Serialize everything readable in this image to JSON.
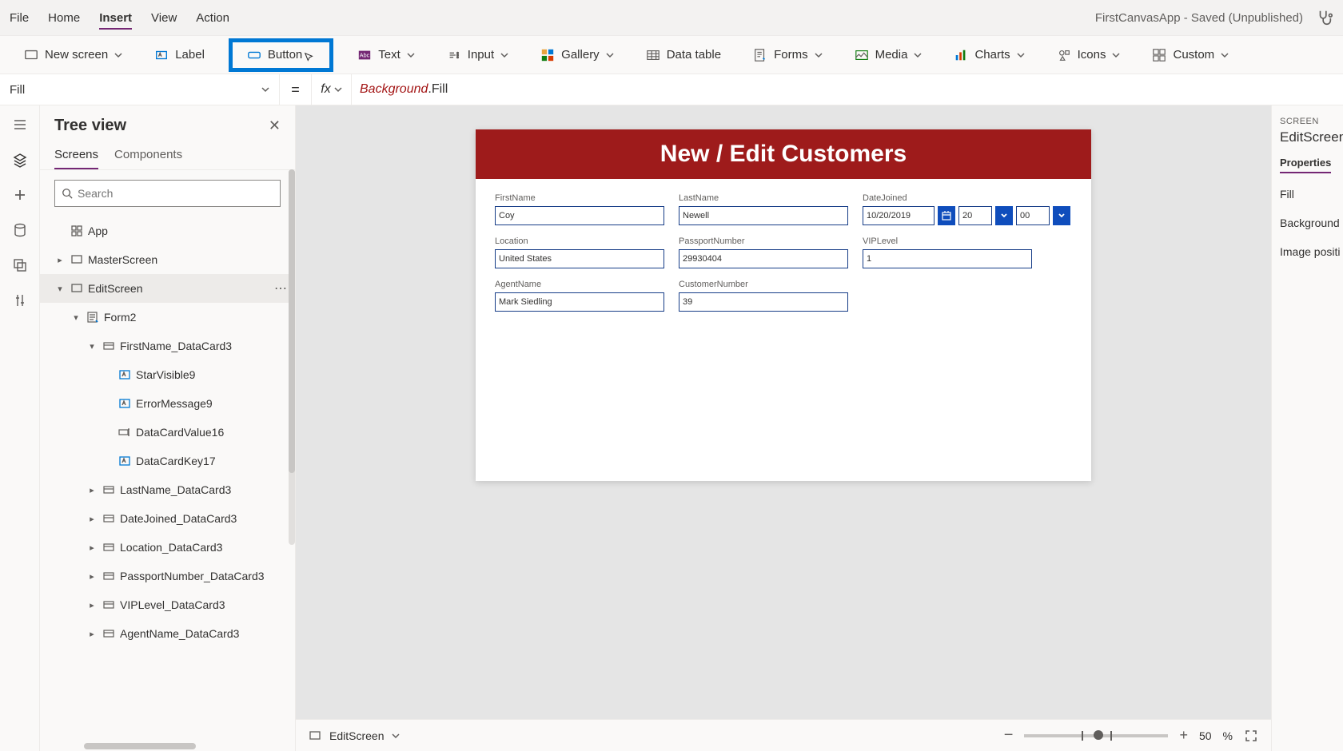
{
  "menubar": {
    "items": [
      "File",
      "Home",
      "Insert",
      "View",
      "Action"
    ],
    "activeIndex": 2,
    "status": "FirstCanvasApp - Saved (Unpublished)"
  },
  "ribbon": {
    "new_screen": "New screen",
    "label": "Label",
    "button": "Button",
    "text": "Text",
    "input": "Input",
    "gallery": "Gallery",
    "data_table": "Data table",
    "forms": "Forms",
    "media": "Media",
    "charts": "Charts",
    "icons": "Icons",
    "custom": "Custom"
  },
  "formula": {
    "property": "Fill",
    "eq": "=",
    "fx": "fx",
    "token_obj": "Background",
    "token_prop": ".Fill"
  },
  "tree": {
    "title": "Tree view",
    "tabs": [
      "Screens",
      "Components"
    ],
    "activeTab": 0,
    "search_placeholder": "Search",
    "nodes": [
      {
        "label": "App",
        "depth": 0,
        "icon": "app",
        "caret": "none"
      },
      {
        "label": "MasterScreen",
        "depth": 0,
        "icon": "screen",
        "caret": "closed"
      },
      {
        "label": "EditScreen",
        "depth": 0,
        "icon": "screen",
        "caret": "open",
        "selected": true,
        "more": true
      },
      {
        "label": "Form2",
        "depth": 1,
        "icon": "form",
        "caret": "open"
      },
      {
        "label": "FirstName_DataCard3",
        "depth": 2,
        "icon": "card",
        "caret": "open"
      },
      {
        "label": "StarVisible9",
        "depth": 3,
        "icon": "label",
        "caret": "none"
      },
      {
        "label": "ErrorMessage9",
        "depth": 3,
        "icon": "label",
        "caret": "none"
      },
      {
        "label": "DataCardValue16",
        "depth": 3,
        "icon": "input",
        "caret": "none"
      },
      {
        "label": "DataCardKey17",
        "depth": 3,
        "icon": "label",
        "caret": "none"
      },
      {
        "label": "LastName_DataCard3",
        "depth": 2,
        "icon": "card",
        "caret": "closed"
      },
      {
        "label": "DateJoined_DataCard3",
        "depth": 2,
        "icon": "card",
        "caret": "closed"
      },
      {
        "label": "Location_DataCard3",
        "depth": 2,
        "icon": "card",
        "caret": "closed"
      },
      {
        "label": "PassportNumber_DataCard3",
        "depth": 2,
        "icon": "card",
        "caret": "closed"
      },
      {
        "label": "VIPLevel_DataCard3",
        "depth": 2,
        "icon": "card",
        "caret": "closed"
      },
      {
        "label": "AgentName_DataCard3",
        "depth": 2,
        "icon": "card",
        "caret": "closed"
      }
    ]
  },
  "screen": {
    "header": "New / Edit Customers",
    "fields": {
      "firstname": {
        "label": "FirstName",
        "value": "Coy"
      },
      "lastname": {
        "label": "LastName",
        "value": "Newell"
      },
      "datejoined": {
        "label": "DateJoined",
        "value": "10/20/2019",
        "hour": "20",
        "min": "00"
      },
      "location": {
        "label": "Location",
        "value": "United States"
      },
      "passport": {
        "label": "PassportNumber",
        "value": "29930404"
      },
      "vip": {
        "label": "VIPLevel",
        "value": "1"
      },
      "agent": {
        "label": "AgentName",
        "value": "Mark Siedling"
      },
      "custno": {
        "label": "CustomerNumber",
        "value": "39"
      }
    }
  },
  "footer": {
    "screen_name": "EditScreen",
    "zoom": "50",
    "zoom_suffix": "%"
  },
  "right": {
    "caption": "SCREEN",
    "name": "EditScreen",
    "tab": "Properties",
    "props": [
      "Fill",
      "Background",
      "Image positi"
    ]
  }
}
